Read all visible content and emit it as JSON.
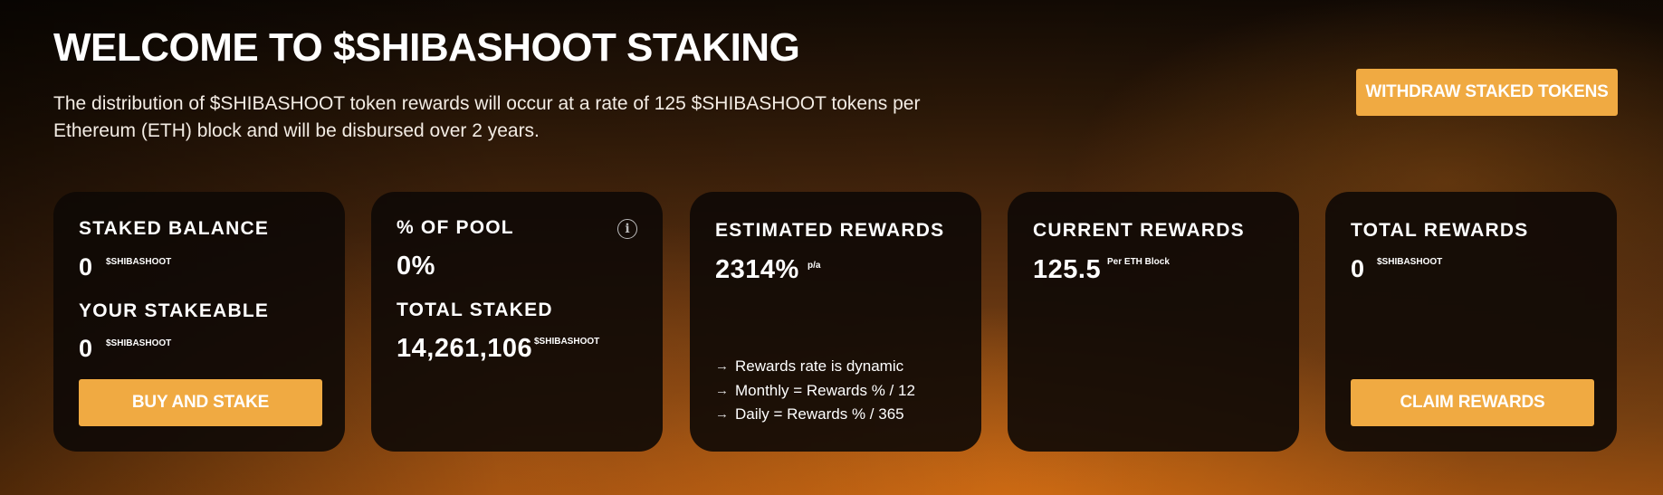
{
  "hero": {
    "title": "WELCOME TO $SHIBASHOOT STAKING",
    "description": "The distribution of $SHIBASHOOT token rewards will occur at a rate of 125 $SHIBASHOOT tokens per Ethereum (ETH) block and will be disbursed over 2 years.",
    "withdraw_label": "WITHDRAW STAKED TOKENS"
  },
  "cards": {
    "staked_balance": {
      "label": "STAKED BALANCE",
      "value": "0",
      "unit": "$SHIBASHOOT",
      "stakeable_label": "YOUR STAKEABLE",
      "stakeable_value": "0",
      "stakeable_unit": "$SHIBASHOOT",
      "button_label": "BUY AND STAKE"
    },
    "pool": {
      "label": "% OF POOL",
      "value": "0%",
      "info_icon": "info-icon",
      "total_label": "TOTAL STAKED",
      "total_value": "14,261,106",
      "total_unit": "$SHIBASHOOT"
    },
    "estimated": {
      "label": "ESTIMATED REWARDS",
      "value": "2314%",
      "unit": "p/a",
      "notes": [
        "Rewards rate is dynamic",
        "Monthly = Rewards % / 12",
        "Daily = Rewards % / 365"
      ]
    },
    "current": {
      "label": "CURRENT REWARDS",
      "value": "125.5",
      "unit": "Per ETH Block"
    },
    "total": {
      "label": "TOTAL REWARDS",
      "value": "0",
      "unit": "$SHIBASHOOT",
      "button_label": "CLAIM REWARDS"
    }
  },
  "colors": {
    "accent": "#f0aa42",
    "card_bg": "#0e0905"
  }
}
